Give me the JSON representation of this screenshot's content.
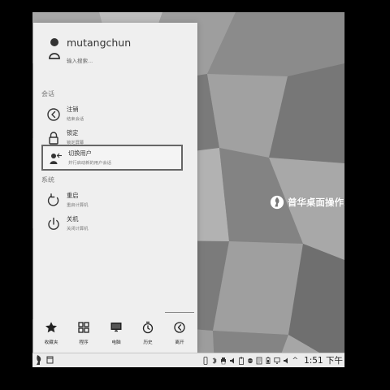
{
  "desktop": {
    "brand_text": "普华桌面操作系统",
    "brand_icon": "puhua-logo-icon"
  },
  "launcher": {
    "user": {
      "name": "mutangchun",
      "avatar_icon": "user-icon"
    },
    "search": {
      "placeholder": "输入搜索..."
    },
    "sections": {
      "session": {
        "title": "会话",
        "items": [
          {
            "title": "注销",
            "subtitle": "结束会话",
            "icon": "logout-icon",
            "selected": false
          },
          {
            "title": "锁定",
            "subtitle": "锁定屏幕",
            "icon": "lock-icon",
            "selected": false
          },
          {
            "title": "切换用户",
            "subtitle": "并行启动新的用户会话",
            "icon": "switch-user-icon",
            "selected": true
          }
        ]
      },
      "system": {
        "title": "系统",
        "items": [
          {
            "title": "重启",
            "subtitle": "重启计算机",
            "icon": "restart-icon",
            "selected": false
          },
          {
            "title": "关机",
            "subtitle": "关闭计算机",
            "icon": "power-icon",
            "selected": false
          }
        ]
      }
    },
    "bottom_nav": [
      {
        "label": "收藏夹",
        "icon": "star-icon"
      },
      {
        "label": "程序",
        "icon": "apps-grid-icon"
      },
      {
        "label": "电脑",
        "icon": "computer-icon"
      },
      {
        "label": "历史",
        "icon": "history-icon"
      },
      {
        "label": "离开",
        "icon": "leave-icon"
      }
    ]
  },
  "taskbar": {
    "left_icons": [
      "start-menu-icon",
      "window-icon"
    ],
    "tray_icons": [
      "phone-icon",
      "bluetooth-icon",
      "printer-icon",
      "volume-icon",
      "clipboard-icon",
      "network-icon",
      "document-icon",
      "battery-icon",
      "screen-icon",
      "volume-small-icon"
    ],
    "caret": "^",
    "time": "1:51 下午"
  },
  "colors": {
    "panel_background": "#efefef",
    "taskbar_background": "#ececec",
    "selected_border": "#666666",
    "wallpaper_base": "#777777"
  }
}
